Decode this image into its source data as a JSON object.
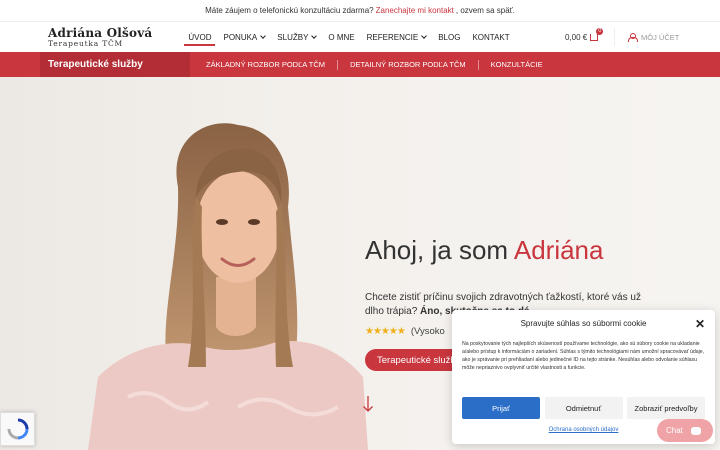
{
  "topbar": {
    "text_before": "Máte záujem o telefonickú konzultáciu zdarma?",
    "link": "Zanechajte mi kontakt",
    "text_after": ", ozvem sa späť."
  },
  "header": {
    "logo_name": "Adriána Olšová",
    "logo_sub": "Terapeutka TČM",
    "nav": [
      {
        "label": "ÚVOD",
        "active": true
      },
      {
        "label": "PONUKA",
        "dropdown": true
      },
      {
        "label": "SLUŽBY",
        "dropdown": true
      },
      {
        "label": "O MNE"
      },
      {
        "label": "REFERENCIE",
        "dropdown": true
      },
      {
        "label": "BLOG"
      },
      {
        "label": "KONTAKT"
      }
    ],
    "cart_total": "0,00 €",
    "cart_count": "0",
    "account_label": "MÔJ ÚČET"
  },
  "subnav": {
    "title": "Terapeutické služby",
    "items": [
      "ZÁKLADNÝ ROZBOR PODĽA TČM",
      "DETAILNÝ ROZBOR PODĽA TČM",
      "KONZULTÁCIE"
    ]
  },
  "hero": {
    "title_start": "Ahoj, ja som ",
    "title_accent": "Adriána",
    "text": "Chcete zistiť príčinu svojich zdravotných ťažkostí, ktoré vás už dlho trápia? ",
    "text_bold": "Áno, skutočne sa to dá.",
    "stars": "★★★★★",
    "rating_text": "(Vysoko",
    "cta_label": "Terapeutické služby"
  },
  "cookie": {
    "title": "Spravujte súhlas so súbormi cookie",
    "body": "Na poskytovanie tých najlepších skúseností používame technológie, ako sú súbory cookie na ukladanie a/alebo prístup k informáciám o zariadení. Súhlas s týmito technológiami nám umožní spracovávať údaje, ako je správanie pri prehliadaní alebo jedinečné ID na tejto stránke. Nesúhlas alebo odvolanie súhlasu môže nepriaznivo ovplyvniť určité vlastnosti a funkcie.",
    "accept": "Prijať",
    "deny": "Odmietnuť",
    "prefs": "Zobraziť predvoľby",
    "link": "Ochrana osobných údajov"
  },
  "chat": {
    "label": "Chat"
  },
  "colors": {
    "accent": "#c9363e",
    "accent_dark": "#b22d35",
    "button_blue": "#2b6ec7",
    "star": "#f2b01e"
  }
}
